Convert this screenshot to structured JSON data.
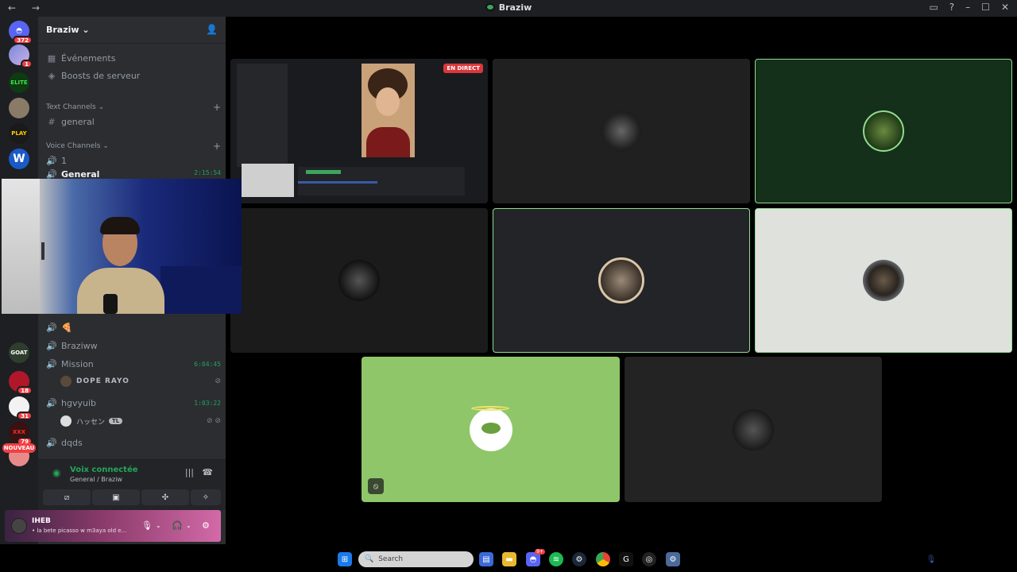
{
  "window": {
    "title": "Braziw",
    "nav": "← →"
  },
  "rail": {
    "badges": {
      "home": "372",
      "s1": "1",
      "s15": "18",
      "s16": "31",
      "s17": "79"
    },
    "new_label": "NOUVEAU",
    "labels": {
      "elite": "ELITE",
      "play": "PLAY",
      "w": "W",
      "goat": "GOAT",
      "xxx": "XXX"
    }
  },
  "server": {
    "name": "Braziw",
    "events": "Événements",
    "boosts": "Boosts de serveur",
    "text_category": "Text Channels",
    "text_channels": [
      "general"
    ],
    "voice_category": "Voice Channels",
    "voice_channels": [
      {
        "name": "1"
      },
      {
        "name": "General",
        "timer": "2:15:54"
      },
      {
        "name": "🍕"
      },
      {
        "name": "Braziww"
      },
      {
        "name": "Mission",
        "timer": "6:04:45"
      },
      {
        "name": "hgvyuib",
        "timer": "1:03:22"
      },
      {
        "name": "dqds"
      }
    ],
    "mission_member": "DOPE RAYO",
    "hgvyuib_member": "ハッセン",
    "hgvyuib_tag": "TL"
  },
  "voice": {
    "status": "Voix connectée",
    "location": "General / Braziw"
  },
  "user": {
    "name": "IHEB",
    "status": "• la bete picasso w m3aya old e..."
  },
  "stage": {
    "live_label": "EN DIRECT"
  },
  "taskbar": {
    "search_placeholder": "Search",
    "discord_badge": "9+"
  },
  "colors": {
    "speaking": "#8fdc90",
    "live": "#da373c",
    "online": "#23a55a"
  }
}
